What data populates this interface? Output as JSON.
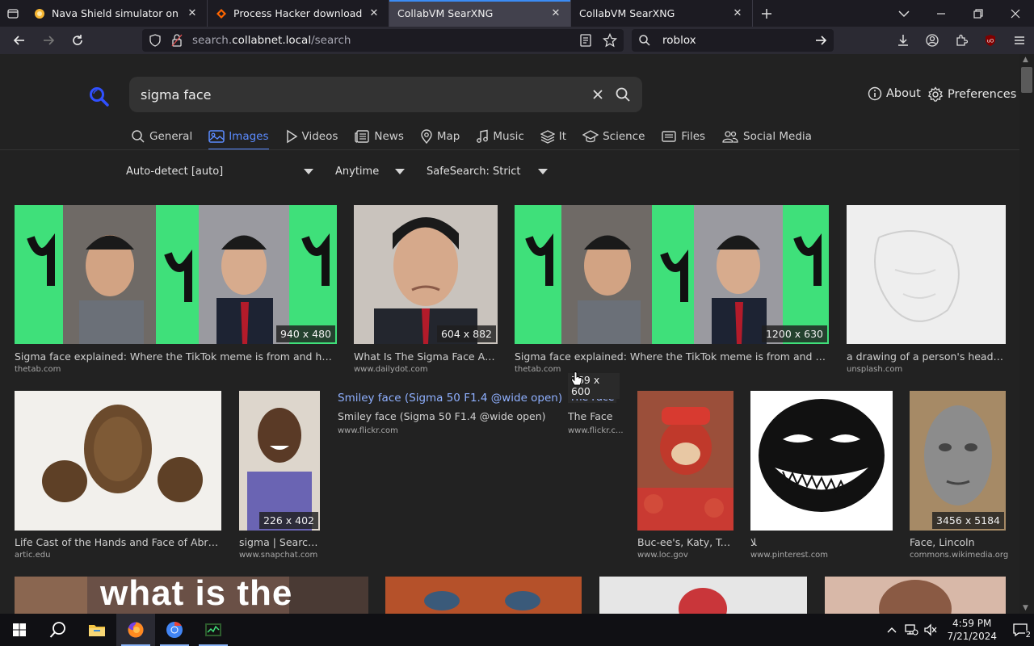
{
  "browser": {
    "tabs": [
      {
        "title": "Nava Shield simulator on Scratc",
        "active": false
      },
      {
        "title": "Process Hacker download | Sour",
        "active": false
      },
      {
        "title": "CollabVM SearXNG",
        "active": true
      },
      {
        "title": "CollabVM SearXNG",
        "active": false
      }
    ],
    "url_prefix": "search.",
    "url_domain": "collabnet.local",
    "url_path": "/search",
    "search_value": "roblox"
  },
  "page": {
    "query": "sigma face",
    "about_label": "About",
    "preferences_label": "Preferences",
    "categories": [
      {
        "label": "General",
        "active": false
      },
      {
        "label": "Images",
        "active": true
      },
      {
        "label": "Videos",
        "active": false
      },
      {
        "label": "News",
        "active": false
      },
      {
        "label": "Map",
        "active": false
      },
      {
        "label": "Music",
        "active": false
      },
      {
        "label": "It",
        "active": false
      },
      {
        "label": "Science",
        "active": false
      },
      {
        "label": "Files",
        "active": false
      },
      {
        "label": "Social Media",
        "active": false
      }
    ],
    "filters": {
      "language": "Auto-detect [auto]",
      "time": "Anytime",
      "safesearch": "SafeSearch: Strict"
    },
    "results_row1": [
      {
        "title": "Sigma face explained: Where the TikTok meme is from and how ...",
        "site": "thetab.com",
        "dims": "940 x 480"
      },
      {
        "title": "What Is The Sigma Face An...",
        "site": "www.dailydot.com",
        "dims": "604 x 882"
      },
      {
        "title": "Sigma face explained: Where the TikTok meme is from and how t...",
        "site": "thetab.com",
        "dims": "1200 x 630"
      },
      {
        "title": "a drawing of a person's head wit...",
        "site": "unsplash.com",
        "dims": ""
      }
    ],
    "results_row2": [
      {
        "title": "Life Cast of the Hands and Face of Abrah...",
        "site": "artic.edu",
        "dims": ""
      },
      {
        "title": "sigma | Search ...",
        "site": "www.snapchat.com",
        "dims": "226 x 402"
      },
      {
        "title": "Buc-ee's, Katy, Te...",
        "site": "www.loc.gov",
        "dims": ""
      },
      {
        "title": "ﻼ",
        "site": "www.pinterest.com",
        "dims": ""
      },
      {
        "title": "Face, Lincoln",
        "site": "commons.wikimedia.org",
        "dims": "3456 x 5184"
      }
    ],
    "detail": {
      "title": "Smiley face (Sigma 50 F1.4 @wide open)",
      "description": "Smiley face (Sigma 50 F1.4 @wide open)",
      "site": "www.flickr.com"
    },
    "hover": {
      "dims_line1": "769 x",
      "dims_line2": "600",
      "sub": "The Face",
      "title": "The Face",
      "site": "www.flickr.c..."
    },
    "row3_caption": "what is the"
  },
  "taskbar": {
    "time": "4:59 PM",
    "date": "7/21/2024",
    "notification_count": "2"
  },
  "colors": {
    "accent": "#5b8bff",
    "tab_indicator": "#3b8cf5",
    "tiktok_green": "#3fe07a"
  }
}
